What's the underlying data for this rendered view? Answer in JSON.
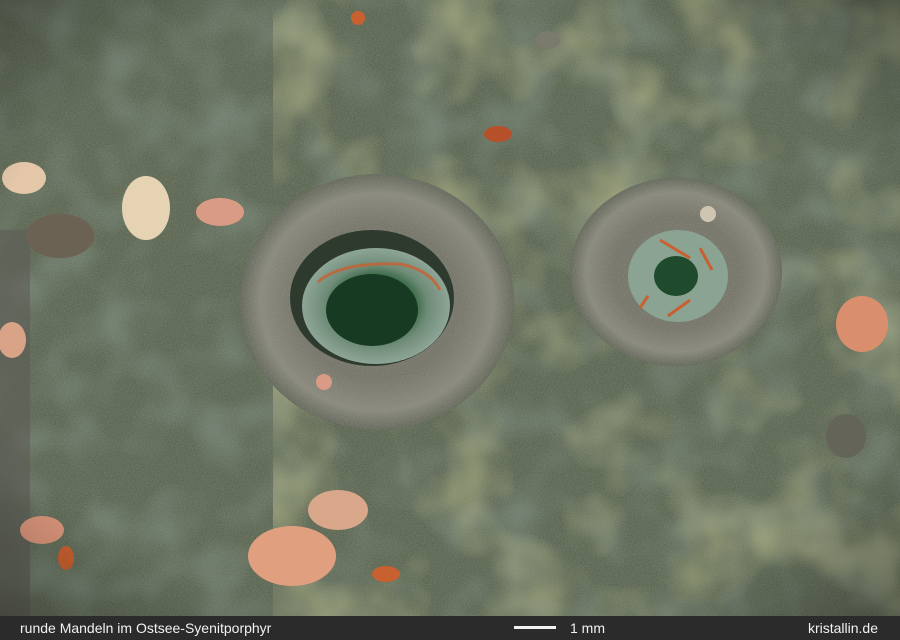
{
  "image": {
    "subject": "Ostsee-Syenitporphyr",
    "colors": {
      "groundmass": "#4f5a45",
      "groundmass_dark": "#3b4637",
      "lichen_yellow": "#a9a84a",
      "amygdale_rim": "#7f7d72",
      "core_green": "#1f4a2c",
      "feldspar_pink": "#d99b86",
      "orange_spots": "#c8602f"
    }
  },
  "caption": {
    "title": "runde Mandeln im Ostsee-Syenitporphyr",
    "scale_label": "1 mm",
    "credit": "kristallin.de"
  }
}
